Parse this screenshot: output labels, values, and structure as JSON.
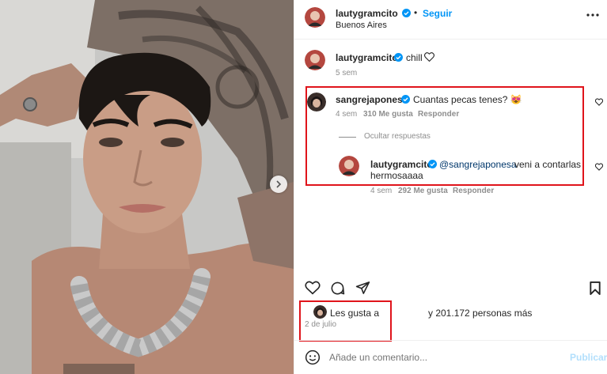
{
  "post": {
    "author": "lautygramcito",
    "follow_label": "Seguir",
    "location": "Buenos Aires",
    "more_icon": "more-options-icon"
  },
  "caption": {
    "author": "lautygramcito",
    "text": "chill",
    "time": "5 sem"
  },
  "comment": {
    "author": "sangrejaponesa",
    "text": "Cuantas pecas tenes? 😻",
    "time": "4 sem",
    "likes": "310 Me gusta",
    "reply_label": "Responder",
    "hide_replies_label": "Ocultar respuestas"
  },
  "reply": {
    "author": "lautygramcito",
    "mention": "@sangrejaponesa",
    "text_line1": "veni a contarlas",
    "text_line2": "hermosaaaa",
    "time": "4 sem",
    "likes": "292 Me gusta",
    "reply_label": "Responder"
  },
  "likes_summary": {
    "prefix": "Les gusta a",
    "suffix": "y 201.172 personas más",
    "date": "2 de julio"
  },
  "composer": {
    "placeholder": "Añade un comentario...",
    "publish_label": "Publicar"
  },
  "colors": {
    "accent": "#0095f6",
    "highlight": "#e0141b",
    "muted": "#8e8e8e"
  }
}
